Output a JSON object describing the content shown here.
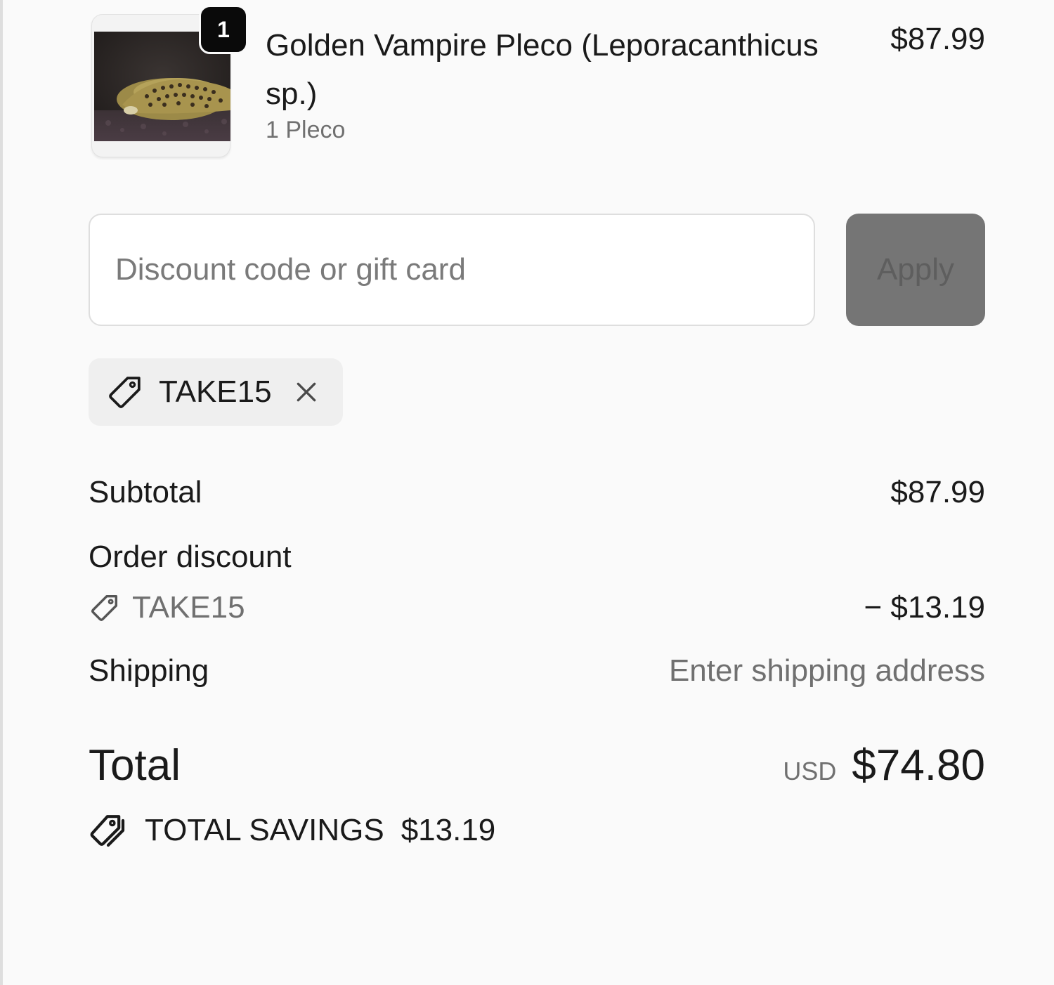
{
  "product": {
    "title": "Golden Vampire Pleco (Leporacanthicus sp.)",
    "variant": "1 Pleco",
    "price": "$87.99",
    "quantity": "1",
    "image_icon": "fish-photo"
  },
  "discount": {
    "placeholder": "Discount code or gift card",
    "apply_label": "Apply",
    "applied_code": "TAKE15"
  },
  "totals": {
    "subtotal_label": "Subtotal",
    "subtotal_value": "$87.99",
    "order_discount_label": "Order discount",
    "discount_code": "TAKE15",
    "discount_value": "− $13.19",
    "shipping_label": "Shipping",
    "shipping_value": "Enter shipping address",
    "total_label": "Total",
    "currency": "USD",
    "total_value": "$74.80",
    "savings_label": "TOTAL SAVINGS",
    "savings_value": "$13.19"
  },
  "colors": {
    "background": "#fafafa",
    "apply_button": "#757575",
    "muted_text": "#707070"
  }
}
